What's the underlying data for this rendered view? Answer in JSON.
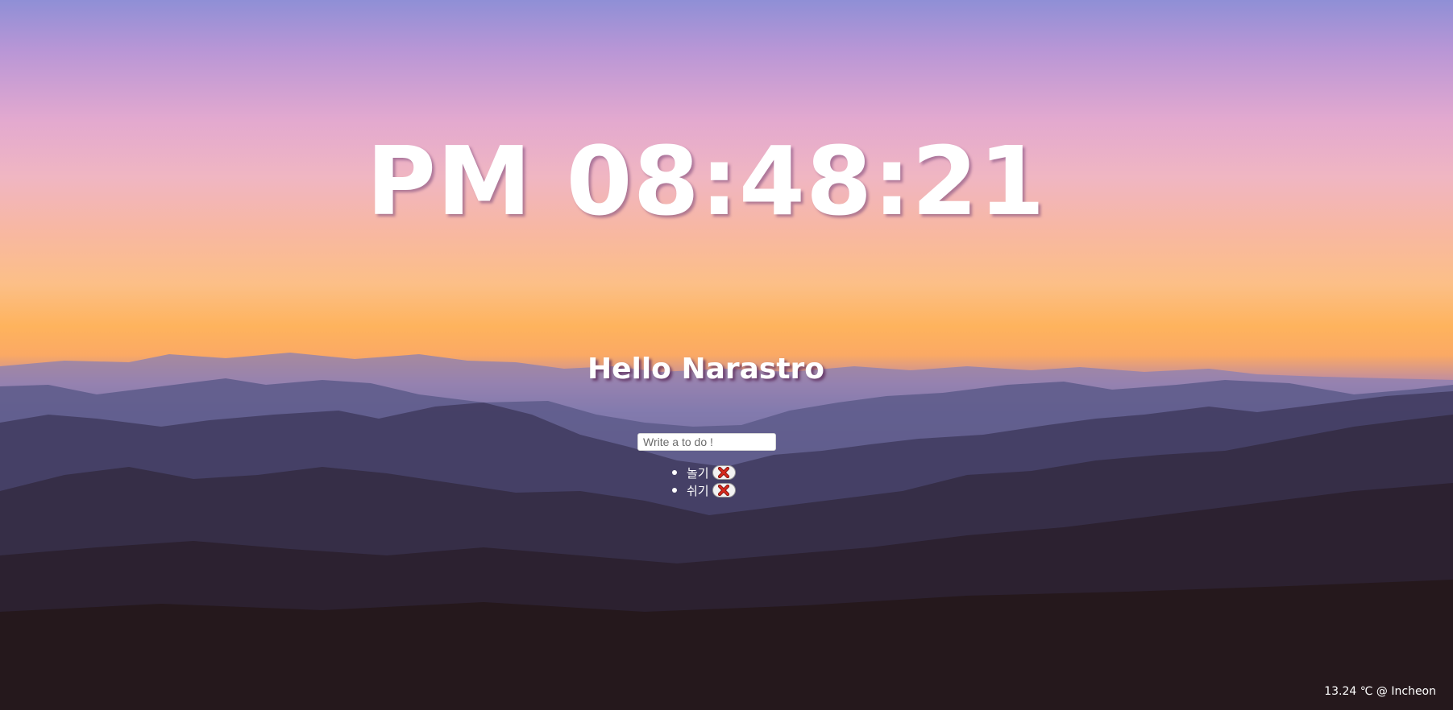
{
  "clock": {
    "time": "PM 08:48:21"
  },
  "greeting": {
    "text": "Hello Narastro"
  },
  "todo_form": {
    "placeholder": "Write a to do !",
    "value": ""
  },
  "todos": [
    {
      "text": "놀기",
      "delete_icon": "red-x-icon"
    },
    {
      "text": "쉬기",
      "delete_icon": "red-x-icon"
    }
  ],
  "weather": {
    "text": "13.24 ℃ @ Incheon"
  },
  "background": {
    "scene": "mountain-sunset",
    "accent_colors": [
      "#b896d6",
      "#f0b6c2",
      "#feb35d",
      "#4b4b74",
      "#241618"
    ]
  }
}
